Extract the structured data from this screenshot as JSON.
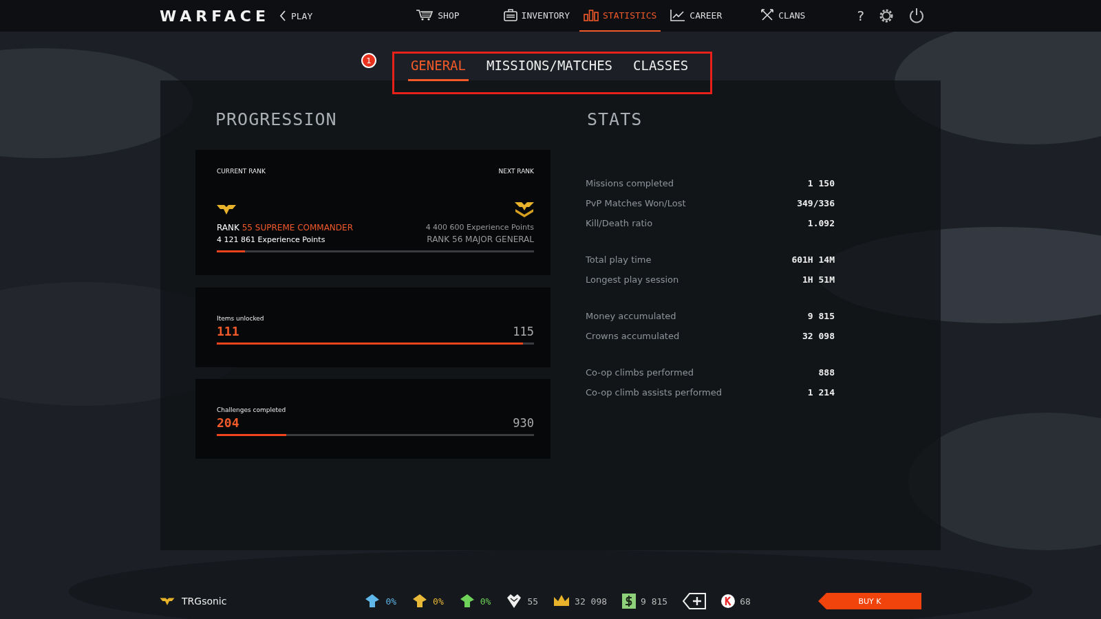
{
  "top_nav": {
    "logo": "WARFACE",
    "back": "PLAY",
    "items": [
      {
        "kind": "shop",
        "label": "SHOP",
        "selected": false
      },
      {
        "kind": "inventory",
        "label": "INVENTORY",
        "selected": false
      },
      {
        "kind": "statistics",
        "label": "STATISTICS",
        "selected": true
      },
      {
        "kind": "career",
        "label": "CAREER",
        "selected": false
      },
      {
        "kind": "clans",
        "label": "CLANS",
        "selected": false
      }
    ],
    "help": "?"
  },
  "tutorial_marker": {
    "badge": "1"
  },
  "tabs": [
    {
      "label": "GENERAL",
      "selected": true
    },
    {
      "label": "MISSIONS/MATCHES",
      "selected": false
    },
    {
      "label": "CLASSES",
      "selected": false
    }
  ],
  "progression": {
    "title": "PROGRESSION",
    "rank_card": {
      "current_label": "CURRENT RANK",
      "next_label": "NEXT RANK",
      "rank_word": "RANK",
      "current_rank": "55 SUPREME COMMANDER",
      "current_xp": "4 121 861 Experience Points",
      "next_xp": "4 400 600 Experience Points",
      "next_rank": "RANK 56 MAJOR GENERAL",
      "level": 0.09
    },
    "counters": [
      {
        "label": "Items unlocked",
        "value": "111",
        "total": "115",
        "level": 0.965
      },
      {
        "label": "Challenges completed",
        "value": "204",
        "total": "930",
        "level": 0.22
      }
    ]
  },
  "stats": {
    "title": "STATS",
    "groups": [
      [
        {
          "label": "Missions completed",
          "value": "1 150"
        },
        {
          "label": "PvP Matches Won/Lost",
          "value": "349/336"
        },
        {
          "label": "Kill/Death ratio",
          "value": "1.092"
        }
      ],
      [
        {
          "label": "Total play time",
          "value": "601H 14M"
        },
        {
          "label": "Longest play session",
          "value": "1H 51M"
        }
      ],
      [
        {
          "label": "Money accumulated",
          "value": "9 815"
        },
        {
          "label": "Crowns accumulated",
          "value": "32 098"
        }
      ],
      [
        {
          "label": "Co-op climbs performed",
          "value": "888"
        },
        {
          "label": "Co-op climb assists performed",
          "value": "1 214"
        }
      ]
    ]
  },
  "status_bar": {
    "player": "TRGsonic",
    "items": [
      {
        "kind": "booster",
        "color": "#5fb6e8",
        "value": "0%"
      },
      {
        "kind": "booster",
        "color": "#e8b838",
        "value": "0%"
      },
      {
        "kind": "booster",
        "color": "#6fd35a",
        "value": "0%"
      },
      {
        "kind": "heart",
        "value": "55"
      },
      {
        "kind": "crown",
        "value": "32 098"
      },
      {
        "kind": "money",
        "value": "9 815"
      },
      {
        "kind": "add"
      },
      {
        "kind": "kredits",
        "value": "68"
      }
    ],
    "buy": "BUY K"
  }
}
